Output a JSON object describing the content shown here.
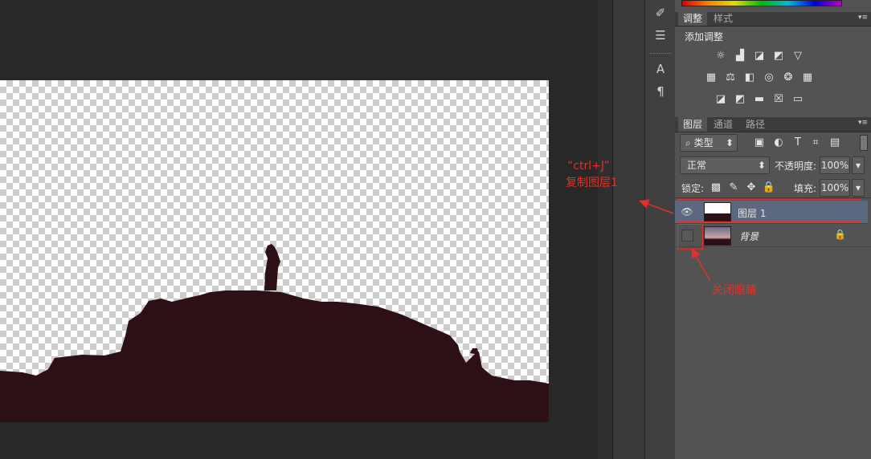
{
  "colors": {
    "accent_red": "#e5302a",
    "silhouette": "#2d1016",
    "panel_bg": "#535353"
  },
  "adjust_panel": {
    "tabs": [
      "调整",
      "样式"
    ],
    "title": "添加调整",
    "icons_row1": [
      "brightness-icon",
      "levels-icon",
      "curves-icon",
      "exposure-icon",
      "vibrance-icon"
    ],
    "icons_row2": [
      "hue-sat-icon",
      "color-balance-icon",
      "black-white-icon",
      "photo-filter-icon",
      "channel-mixer-icon",
      "color-lookup-icon"
    ],
    "icons_row3": [
      "invert-icon",
      "posterize-icon",
      "threshold-icon",
      "selective-color-icon",
      "gradient-map-icon"
    ]
  },
  "layers_panel": {
    "tabs": [
      "图层",
      "通道",
      "路径"
    ],
    "filter_kind": "类型",
    "blend_mode": "正常",
    "opacity_label": "不透明度:",
    "opacity_value": "100%",
    "lock_label": "锁定:",
    "fill_label": "填充:",
    "fill_value": "100%",
    "layers": [
      {
        "name": "图层 1",
        "visible": true,
        "selected": true
      },
      {
        "name": "背景",
        "visible": false,
        "selected": false,
        "locked": true
      }
    ]
  },
  "annotations": {
    "shortcut_line1": "“ctrl+J”",
    "shortcut_line2": "复制图层1",
    "close_eye": "关闭眼睛"
  }
}
